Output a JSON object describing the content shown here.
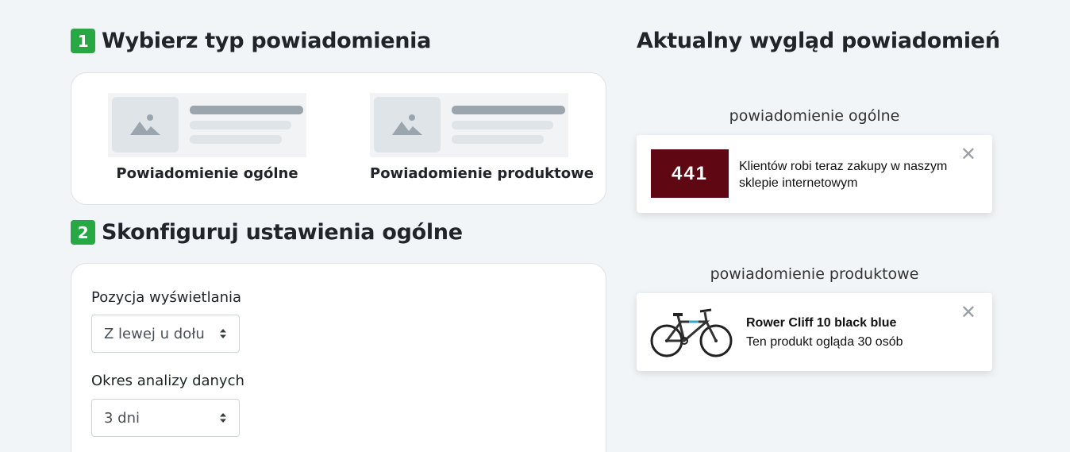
{
  "step1": {
    "number": "1",
    "title": "Wybierz typ powiadomienia"
  },
  "types": [
    {
      "label": "Powiadomienie ogólne",
      "image_icon": "image-placeholder-icon"
    },
    {
      "label": "Powiadomienie produktowe",
      "image_icon": "image-placeholder-icon"
    }
  ],
  "step2": {
    "number": "2",
    "title": "Skonfiguruj ustawienia ogólne"
  },
  "config": {
    "position": {
      "label": "Pozycja wyświetlania",
      "value": "Z lewej u dołu"
    },
    "period": {
      "label": "Okres analizy danych",
      "value": "3 dni"
    }
  },
  "preview": {
    "title": "Aktualny wygląd powiadomień",
    "general": {
      "caption": "powiadomienie ogólne",
      "counter": "441",
      "text": "Klientów robi teraz zakupy w naszym sklepie internetowym",
      "counter_color": "#5f0712"
    },
    "product": {
      "caption": "powiadomienie produktowe",
      "name": "Rower Cliff 10 black blue",
      "subtitle": "Ten produkt ogląda 30 osób",
      "image_icon": "bicycle-icon"
    }
  },
  "colors": {
    "accent": "#28a745",
    "background": "#f2f5f8"
  }
}
